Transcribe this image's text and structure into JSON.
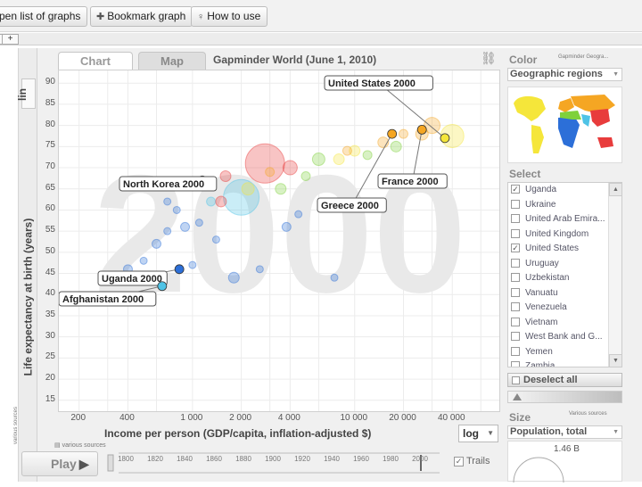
{
  "toolbar": {
    "open_list": "pen list of graphs",
    "bookmark": "Bookmark graph",
    "how_to": "How to use"
  },
  "strip": {
    "add_tab": "+"
  },
  "tabs": [
    {
      "label": "Chart",
      "active": true
    },
    {
      "label": "Map",
      "active": false
    }
  ],
  "graph_title": "Gapminder World (June 1, 2010)",
  "y_scale_button": "lin",
  "axes": {
    "y_label": "Life expectancy at birth (years)",
    "x_label": "Income per person (GDP/capita, inflation-adjusted $)",
    "y_ticks": [
      "90",
      "85",
      "80",
      "75",
      "70",
      "65",
      "60",
      "55",
      "50",
      "45",
      "40",
      "35",
      "30",
      "25",
      "20",
      "15"
    ],
    "x_ticks": [
      "200",
      "400",
      "1 000",
      "2 000",
      "4 000",
      "10 000",
      "20 000",
      "40 000"
    ],
    "x_scale": "log",
    "various_sources": "various sources"
  },
  "year_watermark": "2000",
  "play_label": "Play",
  "timeline_ticks": [
    "1800",
    "1820",
    "1840",
    "1860",
    "1880",
    "1900",
    "1920",
    "1940",
    "1960",
    "1980",
    "2000"
  ],
  "trails_label": "Trails",
  "colors": {
    "sub_saharan_africa": "#2c6fd8",
    "south_asia": "#4fc3e6",
    "east_asia_pacific": "#e83c3c",
    "america": "#f5e63a",
    "europe_central_asia": "#f5a623",
    "middle_east_north_africa": "#7fd13b"
  },
  "chart_data": {
    "type": "scatter",
    "title": "Gapminder World (June 1, 2010)",
    "xlabel": "Income per person (GDP/capita, inflation-adjusted $)",
    "ylabel": "Life expectancy at birth (years)",
    "x_scale": "log",
    "xlim": [
      150,
      80000
    ],
    "ylim": [
      12,
      93
    ],
    "year": "2000",
    "labeled_points": [
      {
        "label": "United States 2000",
        "x": 36000,
        "y": 77,
        "color": "#f5e63a"
      },
      {
        "label": "France 2000",
        "x": 26000,
        "y": 79,
        "color": "#f5a623"
      },
      {
        "label": "Greece 2000",
        "x": 17000,
        "y": 78,
        "color": "#f5a623"
      },
      {
        "label": "North Korea 2000",
        "x": 1150,
        "y": 67,
        "color": "#e83c3c"
      },
      {
        "label": "Uganda 2000",
        "x": 830,
        "y": 46,
        "color": "#2c6fd8"
      },
      {
        "label": "Afghanistan 2000",
        "x": 650,
        "y": 42,
        "color": "#4fc3e6"
      }
    ],
    "bubbles": [
      {
        "x": 40000,
        "y": 77.5,
        "r": 13,
        "c": "#f5e63a"
      },
      {
        "x": 2800,
        "y": 71,
        "r": 22,
        "c": "#e83c3c"
      },
      {
        "x": 2000,
        "y": 63,
        "r": 20,
        "c": "#4fc3e6"
      },
      {
        "x": 30000,
        "y": 80,
        "r": 9,
        "c": "#f5a623"
      },
      {
        "x": 26000,
        "y": 78,
        "r": 7,
        "c": "#f5a623"
      },
      {
        "x": 4000,
        "y": 70,
        "r": 8,
        "c": "#e83c3c"
      },
      {
        "x": 3500,
        "y": 65,
        "r": 6,
        "c": "#7fd13b"
      },
      {
        "x": 6000,
        "y": 72,
        "r": 7,
        "c": "#7fd13b"
      },
      {
        "x": 10000,
        "y": 74,
        "r": 6,
        "c": "#f5e63a"
      },
      {
        "x": 15000,
        "y": 76,
        "r": 6,
        "c": "#f5a623"
      },
      {
        "x": 20000,
        "y": 78,
        "r": 5,
        "c": "#f5a623"
      },
      {
        "x": 8000,
        "y": 72,
        "r": 6,
        "c": "#f5e63a"
      },
      {
        "x": 5000,
        "y": 68,
        "r": 5,
        "c": "#7fd13b"
      },
      {
        "x": 12000,
        "y": 73,
        "r": 5,
        "c": "#7fd13b"
      },
      {
        "x": 2200,
        "y": 65,
        "r": 7,
        "c": "#f5e63a"
      },
      {
        "x": 1600,
        "y": 68,
        "r": 6,
        "c": "#e83c3c"
      },
      {
        "x": 1300,
        "y": 62,
        "r": 5,
        "c": "#4fc3e6"
      },
      {
        "x": 900,
        "y": 56,
        "r": 5,
        "c": "#2c6fd8"
      },
      {
        "x": 700,
        "y": 55,
        "r": 4,
        "c": "#2c6fd8"
      },
      {
        "x": 1100,
        "y": 57,
        "r": 4,
        "c": "#2c6fd8"
      },
      {
        "x": 600,
        "y": 52,
        "r": 5,
        "c": "#2c6fd8"
      },
      {
        "x": 500,
        "y": 48,
        "r": 4,
        "c": "#2c6fd8"
      },
      {
        "x": 400,
        "y": 46,
        "r": 5,
        "c": "#2c6fd8"
      },
      {
        "x": 1800,
        "y": 44,
        "r": 6,
        "c": "#2c6fd8"
      },
      {
        "x": 2600,
        "y": 46,
        "r": 4,
        "c": "#2c6fd8"
      },
      {
        "x": 800,
        "y": 60,
        "r": 4,
        "c": "#2c6fd8"
      },
      {
        "x": 1400,
        "y": 53,
        "r": 4,
        "c": "#2c6fd8"
      },
      {
        "x": 1000,
        "y": 47,
        "r": 4,
        "c": "#2c6fd8"
      },
      {
        "x": 4500,
        "y": 59,
        "r": 4,
        "c": "#2c6fd8"
      },
      {
        "x": 700,
        "y": 62,
        "r": 4,
        "c": "#2c6fd8"
      },
      {
        "x": 1500,
        "y": 62,
        "r": 6,
        "c": "#e83c3c"
      },
      {
        "x": 18000,
        "y": 75,
        "r": 6,
        "c": "#7fd13b"
      },
      {
        "x": 9000,
        "y": 74,
        "r": 5,
        "c": "#f5a623"
      },
      {
        "x": 3000,
        "y": 69,
        "r": 5,
        "c": "#f5a623"
      },
      {
        "x": 3800,
        "y": 56,
        "r": 5,
        "c": "#2c6fd8"
      },
      {
        "x": 7500,
        "y": 44,
        "r": 4,
        "c": "#2c6fd8"
      }
    ]
  },
  "right_panel": {
    "color_title": "Color",
    "color_source": "Gapminder Geogra...",
    "color_select": "Geographic regions",
    "select_title": "Select",
    "countries": [
      {
        "name": "Uganda",
        "checked": true
      },
      {
        "name": "Ukraine",
        "checked": false
      },
      {
        "name": "United Arab Emira...",
        "checked": false
      },
      {
        "name": "United Kingdom",
        "checked": false
      },
      {
        "name": "United States",
        "checked": true
      },
      {
        "name": "Uruguay",
        "checked": false
      },
      {
        "name": "Uzbekistan",
        "checked": false
      },
      {
        "name": "Vanuatu",
        "checked": false
      },
      {
        "name": "Venezuela",
        "checked": false
      },
      {
        "name": "Vietnam",
        "checked": false
      },
      {
        "name": "West Bank and G...",
        "checked": false
      },
      {
        "name": "Yemen",
        "checked": false
      },
      {
        "name": "Zambia",
        "checked": false
      }
    ],
    "deselect_all": "Deselect all",
    "size_title": "Size",
    "size_sources": "Various sources",
    "size_select": "Population, total",
    "size_value": "1.46 B"
  }
}
